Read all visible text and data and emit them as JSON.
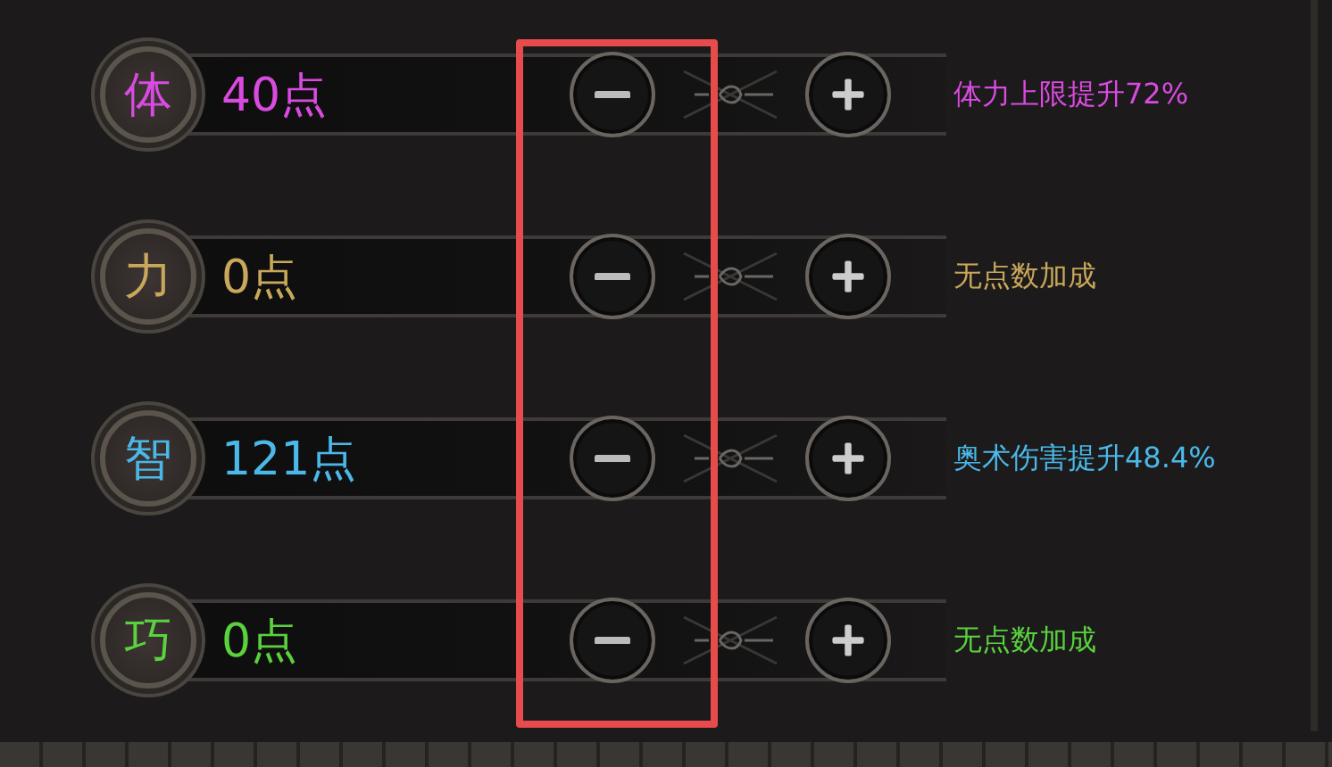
{
  "stats": [
    {
      "badge": "体",
      "value": "40点",
      "bonus": "体力上限提升72%",
      "color": "#d94be0"
    },
    {
      "badge": "力",
      "value": "0点",
      "bonus": "无点数加成",
      "color": "#c8a85a"
    },
    {
      "badge": "智",
      "value": "121点",
      "bonus": "奥术伤害提升48.4%",
      "color": "#4ab8e8"
    },
    {
      "badge": "巧",
      "value": "0点",
      "bonus": "无点数加成",
      "color": "#5ad13e"
    }
  ]
}
